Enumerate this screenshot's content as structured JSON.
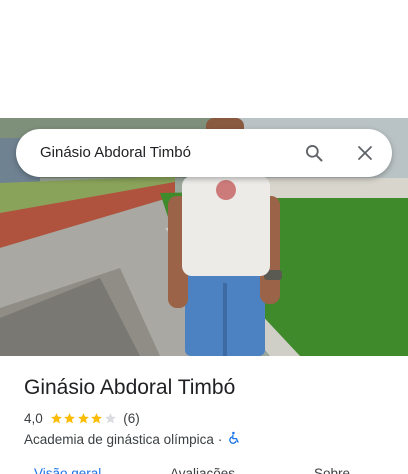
{
  "search": {
    "query": "Ginásio Abdoral Timbó",
    "search_icon": "search-icon",
    "close_icon": "close-icon"
  },
  "place": {
    "name": "Ginásio Abdoral Timbó",
    "rating": 4.0,
    "rating_text": "4,0",
    "review_count_text": "(6)",
    "category": "Academia de ginástica olímpica",
    "separator": "·",
    "accessibility_icon": "wheelchair-accessible-icon"
  },
  "tabs": [
    {
      "label": "Visão geral",
      "active": true
    },
    {
      "label": "Avaliações",
      "active": false
    },
    {
      "label": "Sobre",
      "active": false
    }
  ],
  "colors": {
    "star": "#fbbc04",
    "star_empty": "#dadce0",
    "accent": "#1a73e8",
    "text": "#202124",
    "secondary_text": "#3c4043"
  }
}
